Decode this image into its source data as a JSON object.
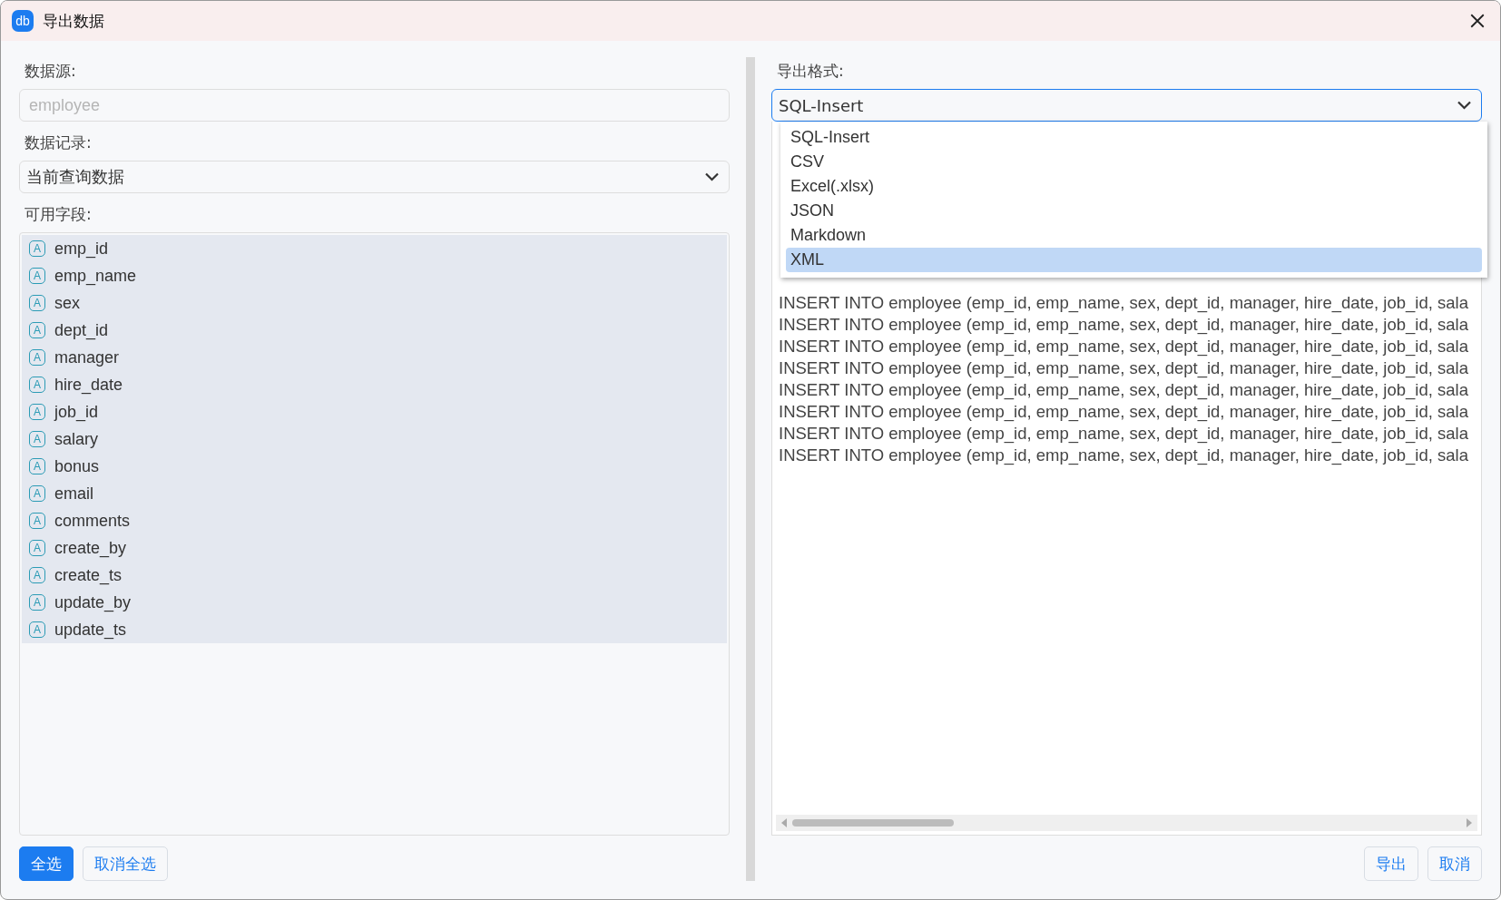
{
  "window": {
    "title": "导出数据",
    "logo": "db"
  },
  "source": {
    "label": "数据源:",
    "placeholder": "employee"
  },
  "records": {
    "label": "数据记录:",
    "value": "当前查询数据"
  },
  "fields": {
    "label": "可用字段:",
    "items": [
      {
        "badge": "A",
        "name": "emp_id",
        "selected": true
      },
      {
        "badge": "A",
        "name": "emp_name",
        "selected": true
      },
      {
        "badge": "A",
        "name": "sex",
        "selected": true
      },
      {
        "badge": "A",
        "name": "dept_id",
        "selected": true
      },
      {
        "badge": "A",
        "name": "manager",
        "selected": true
      },
      {
        "badge": "A",
        "name": "hire_date",
        "selected": true
      },
      {
        "badge": "A",
        "name": "job_id",
        "selected": true
      },
      {
        "badge": "A",
        "name": "salary",
        "selected": true
      },
      {
        "badge": "A",
        "name": "bonus",
        "selected": true
      },
      {
        "badge": "A",
        "name": "email",
        "selected": true
      },
      {
        "badge": "A",
        "name": "comments",
        "selected": true
      },
      {
        "badge": "A",
        "name": "create_by",
        "selected": true
      },
      {
        "badge": "A",
        "name": "create_ts",
        "selected": true
      },
      {
        "badge": "A",
        "name": "update_by",
        "selected": true
      },
      {
        "badge": "A",
        "name": "update_ts",
        "selected": true
      }
    ]
  },
  "left_buttons": [
    {
      "label": "全选",
      "kind": "primary"
    },
    {
      "label": "取消全选",
      "kind": "plain"
    }
  ],
  "format": {
    "label": "导出格式:",
    "value": "SQL-Insert",
    "expanded": true,
    "options": [
      {
        "label": "SQL-Insert",
        "highlighted": false
      },
      {
        "label": "CSV",
        "highlighted": false
      },
      {
        "label": "Excel(.xlsx)",
        "highlighted": false
      },
      {
        "label": "JSON",
        "highlighted": false
      },
      {
        "label": "Markdown",
        "highlighted": false
      },
      {
        "label": "XML",
        "highlighted": true
      }
    ]
  },
  "preview": {
    "lines": [
      "INSERT INTO employee (emp_id, emp_name, sex, dept_id, manager, hire_date, job_id, sala",
      "INSERT INTO employee (emp_id, emp_name, sex, dept_id, manager, hire_date, job_id, sala",
      "INSERT INTO employee (emp_id, emp_name, sex, dept_id, manager, hire_date, job_id, sala",
      "INSERT INTO employee (emp_id, emp_name, sex, dept_id, manager, hire_date, job_id, sala",
      "INSERT INTO employee (emp_id, emp_name, sex, dept_id, manager, hire_date, job_id, sala",
      "INSERT INTO employee (emp_id, emp_name, sex, dept_id, manager, hire_date, job_id, sala",
      "INSERT INTO employee (emp_id, emp_name, sex, dept_id, manager, hire_date, job_id, sala",
      "INSERT INTO employee (emp_id, emp_name, sex, dept_id, manager, hire_date, job_id, sala"
    ]
  },
  "right_buttons": [
    {
      "label": "导出",
      "kind": "plain"
    },
    {
      "label": "取消",
      "kind": "plain"
    }
  ]
}
